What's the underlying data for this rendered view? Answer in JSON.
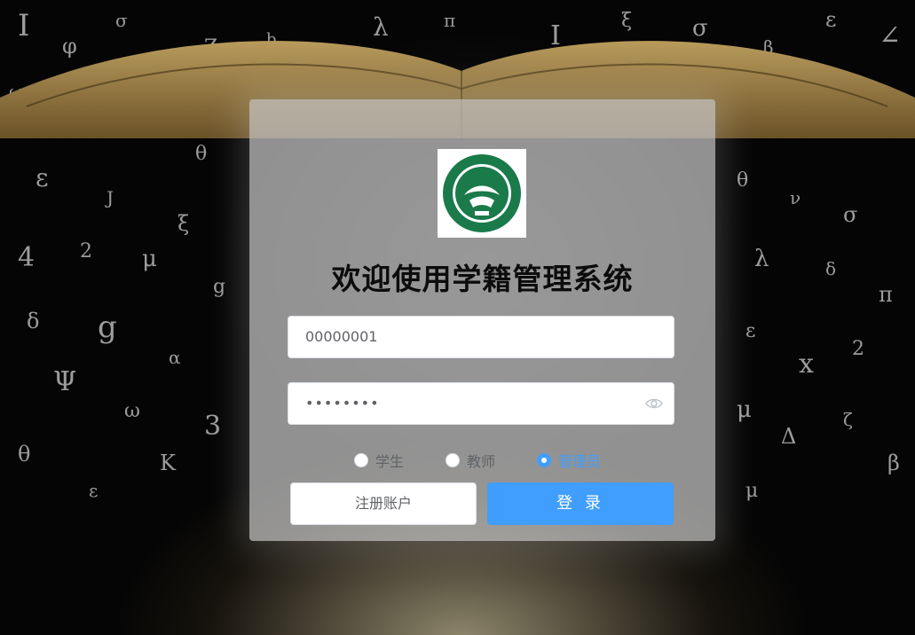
{
  "page": {
    "title": "欢迎使用学籍管理系统"
  },
  "login_form": {
    "username_value": "00000001",
    "password_value": "••••••••",
    "roles": [
      {
        "label": "学生",
        "selected": false
      },
      {
        "label": "教师",
        "selected": false
      },
      {
        "label": "管理员",
        "selected": true
      }
    ],
    "register_label": "注册账户",
    "login_label": "登 录"
  },
  "icons": {
    "logo": "school-emblem-icon",
    "password_toggle": "eye-icon"
  },
  "colors": {
    "primary": "#409eff",
    "card_bg": "#c8c8c8",
    "logo_green": "#1a7a4a"
  }
}
